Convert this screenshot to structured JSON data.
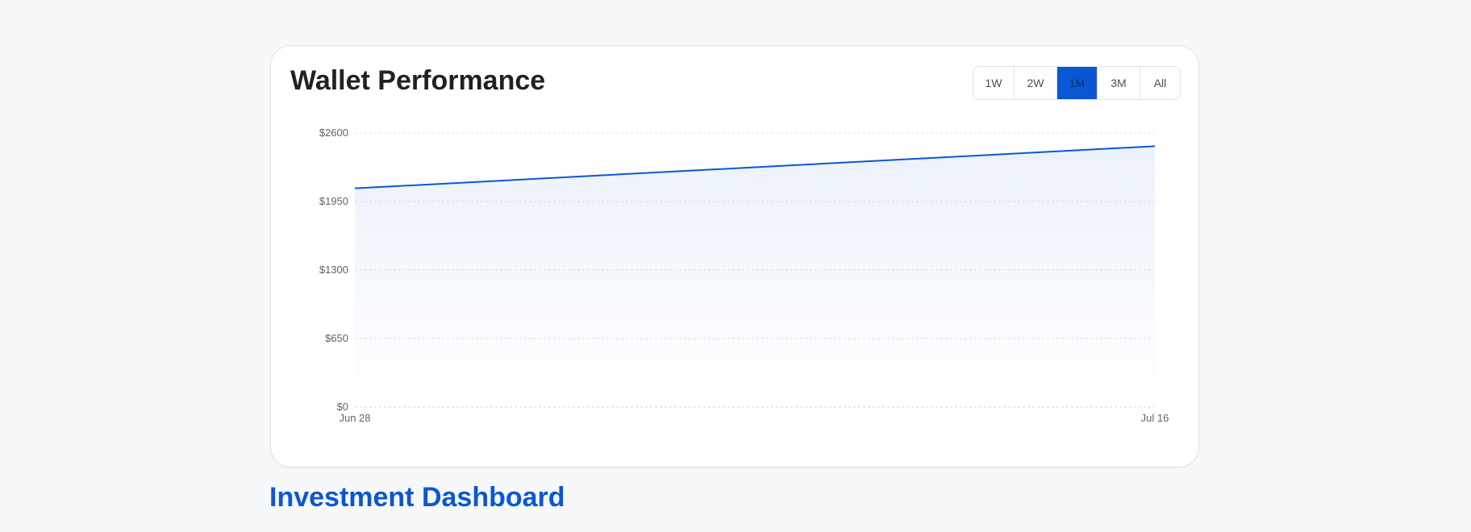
{
  "card": {
    "title": "Wallet Performance",
    "ranges": [
      {
        "label": "1W",
        "name": "range-1w-button"
      },
      {
        "label": "2W",
        "name": "range-2w-button"
      },
      {
        "label": "1M",
        "name": "range-1m-button",
        "active": true
      },
      {
        "label": "3M",
        "name": "range-3m-button"
      },
      {
        "label": "All",
        "name": "range-all-button"
      }
    ]
  },
  "chart_data": {
    "type": "area",
    "x": [
      "Jun 28",
      "Jul 16"
    ],
    "x_tick_labels": [
      "Jun 28",
      "Jul 16"
    ],
    "y_tick_labels": [
      "$0",
      "$650",
      "$1300",
      "$1950",
      "$2600"
    ],
    "y_ticks": [
      0,
      650,
      1300,
      1950,
      2600
    ],
    "series": [
      {
        "values": [
          2075,
          2475
        ],
        "color": "#0a57d6"
      }
    ],
    "ylim": [
      0,
      2600
    ],
    "grid": true,
    "line_color": "#0a57d6"
  },
  "page": {
    "heading": "Investment Dashboard"
  }
}
